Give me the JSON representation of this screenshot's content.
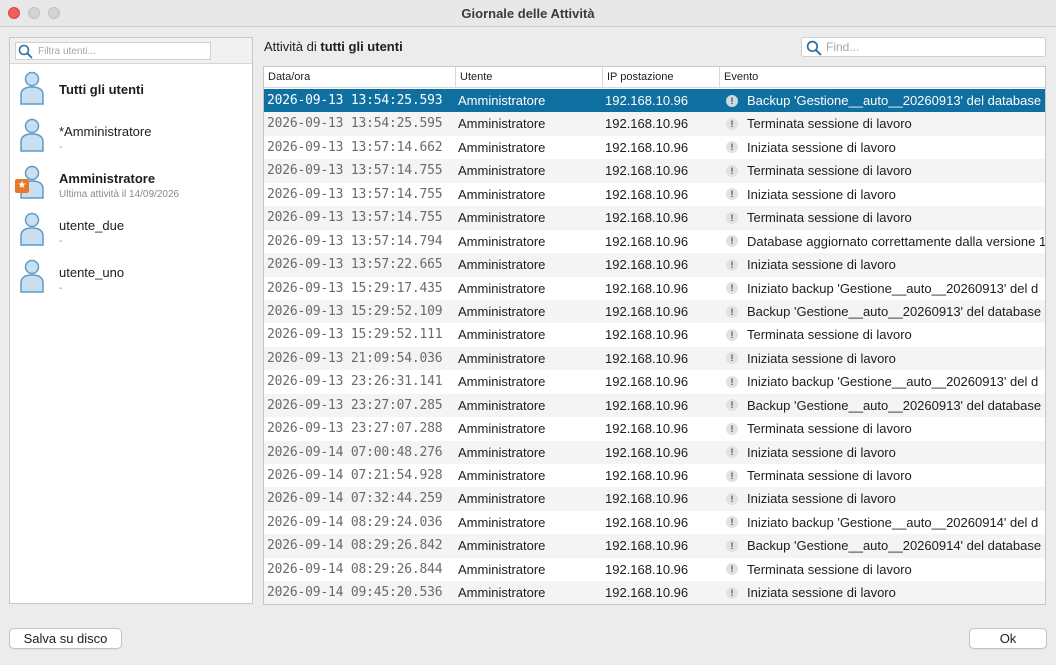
{
  "window": {
    "title": "Giornale delle Attività"
  },
  "sidebar": {
    "filter_placeholder": "Filtra utenti...",
    "users": [
      {
        "name": "Tutti gli utenti",
        "sub": ""
      },
      {
        "name": "*Amministratore",
        "sub": "-"
      },
      {
        "name": "Amministratore",
        "sub": "Ultima attività il 14/09/2026"
      },
      {
        "name": "utente_due",
        "sub": "-"
      },
      {
        "name": "utente_uno",
        "sub": "-"
      }
    ]
  },
  "main": {
    "heading_prefix": "Attività di",
    "heading_target": "tutti gli utenti",
    "find_placeholder": "Find...",
    "columns": [
      "Data/ora",
      "Utente",
      "IP postazione",
      "Evento"
    ],
    "rows": [
      [
        "2026-09-13 13:54:25.593",
        "Amministratore",
        "192.168.10.96",
        "Backup 'Gestione__auto__20260913' del database"
      ],
      [
        "2026-09-13 13:54:25.595",
        "Amministratore",
        "192.168.10.96",
        "Terminata sessione di lavoro"
      ],
      [
        "2026-09-13 13:57:14.662",
        "Amministratore",
        "192.168.10.96",
        "Iniziata sessione di lavoro"
      ],
      [
        "2026-09-13 13:57:14.755",
        "Amministratore",
        "192.168.10.96",
        "Terminata sessione di lavoro"
      ],
      [
        "2026-09-13 13:57:14.755",
        "Amministratore",
        "192.168.10.96",
        "Iniziata sessione di lavoro"
      ],
      [
        "2026-09-13 13:57:14.755",
        "Amministratore",
        "192.168.10.96",
        "Terminata sessione di lavoro"
      ],
      [
        "2026-09-13 13:57:14.794",
        "Amministratore",
        "192.168.10.96",
        "Database aggiornato correttamente dalla versione 1"
      ],
      [
        "2026-09-13 13:57:22.665",
        "Amministratore",
        "192.168.10.96",
        "Iniziata sessione di lavoro"
      ],
      [
        "2026-09-13 15:29:17.435",
        "Amministratore",
        "192.168.10.96",
        "Iniziato backup 'Gestione__auto__20260913' del d"
      ],
      [
        "2026-09-13 15:29:52.109",
        "Amministratore",
        "192.168.10.96",
        "Backup 'Gestione__auto__20260913' del database"
      ],
      [
        "2026-09-13 15:29:52.111",
        "Amministratore",
        "192.168.10.96",
        "Terminata sessione di lavoro"
      ],
      [
        "2026-09-13 21:09:54.036",
        "Amministratore",
        "192.168.10.96",
        "Iniziata sessione di lavoro"
      ],
      [
        "2026-09-13 23:26:31.141",
        "Amministratore",
        "192.168.10.96",
        "Iniziato backup 'Gestione__auto__20260913' del d"
      ],
      [
        "2026-09-13 23:27:07.285",
        "Amministratore",
        "192.168.10.96",
        "Backup 'Gestione__auto__20260913' del database"
      ],
      [
        "2026-09-13 23:27:07.288",
        "Amministratore",
        "192.168.10.96",
        "Terminata sessione di lavoro"
      ],
      [
        "2026-09-14 07:00:48.276",
        "Amministratore",
        "192.168.10.96",
        "Iniziata sessione di lavoro"
      ],
      [
        "2026-09-14 07:21:54.928",
        "Amministratore",
        "192.168.10.96",
        "Terminata sessione di lavoro"
      ],
      [
        "2026-09-14 07:32:44.259",
        "Amministratore",
        "192.168.10.96",
        "Iniziata sessione di lavoro"
      ],
      [
        "2026-09-14 08:29:24.036",
        "Amministratore",
        "192.168.10.96",
        "Iniziato backup 'Gestione__auto__20260914' del d"
      ],
      [
        "2026-09-14 08:29:26.842",
        "Amministratore",
        "192.168.10.96",
        "Backup 'Gestione__auto__20260914' del database"
      ],
      [
        "2026-09-14 08:29:26.844",
        "Amministratore",
        "192.168.10.96",
        "Terminata sessione di lavoro"
      ],
      [
        "2026-09-14 09:45:20.536",
        "Amministratore",
        "192.168.10.96",
        "Iniziata sessione di lavoro"
      ]
    ],
    "event_icon_glyph": "!"
  },
  "footer": {
    "save_label": "Salva su disco",
    "ok_label": "Ok"
  },
  "colors": {
    "selection": "#0f6fa0",
    "badge": "#e8772b",
    "avatar": "#5b9cc9"
  }
}
